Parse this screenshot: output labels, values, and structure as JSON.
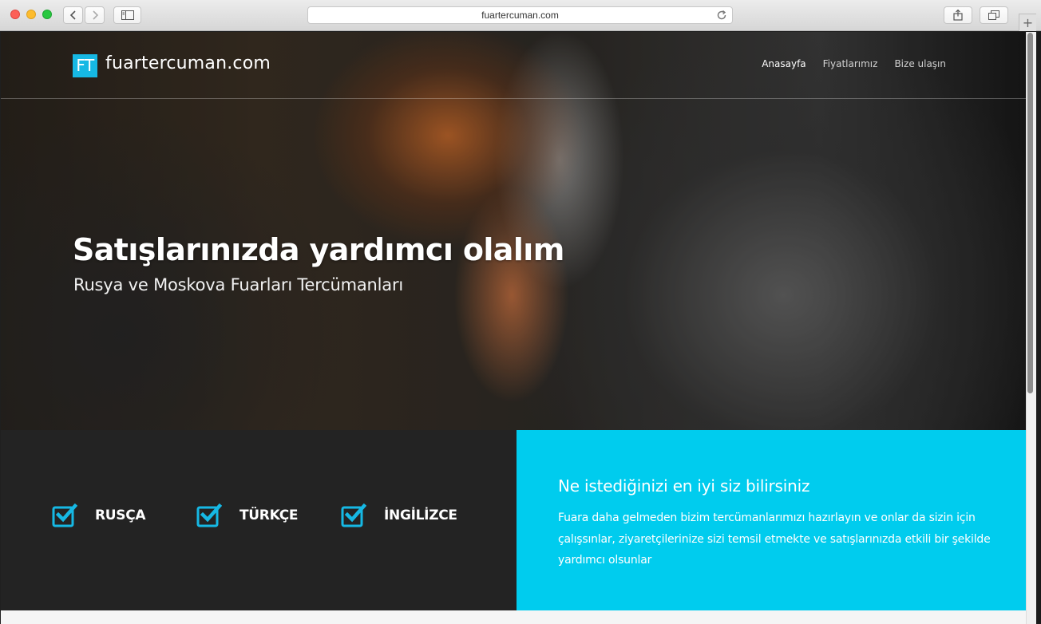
{
  "browser": {
    "url": "fuartercuman.com"
  },
  "site": {
    "logo_badge": "FT",
    "logo_text": "fuartercuman.com",
    "nav": [
      "Anasayfa",
      "Fiyatlarımız",
      "Bize ulaşın"
    ]
  },
  "hero": {
    "title": "Satışlarınızda yardımcı olalım",
    "subtitle": "Rusya ve Moskova Fuarları Tercümanları"
  },
  "features": {
    "languages": [
      "RUSÇA",
      "TÜRKÇE",
      "İNGİLİZCE"
    ]
  },
  "info": {
    "heading": "Ne istediğinizi en iyi siz bilirsiniz",
    "text": "Fuara daha gelmeden bizim tercümanlarımızı hazırlayın ve onlar da sizin için çalışsınlar, ziyaretçilerinize sizi temsil etmekte ve satışlarınızda etkili bir şekilde yardımcı olsunlar"
  },
  "colors": {
    "accent": "#00ccee",
    "logo": "#16b8e4",
    "dark_band": "#232323"
  }
}
